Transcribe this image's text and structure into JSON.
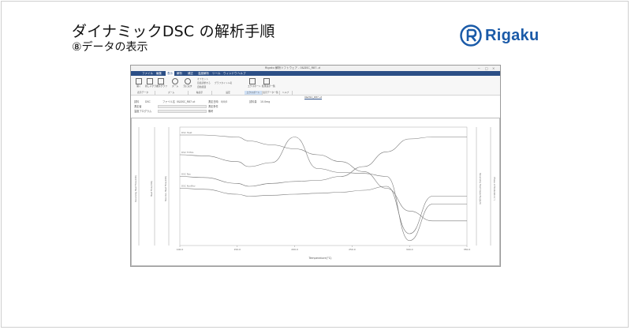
{
  "slide": {
    "title": "ダイナミックDSC の解析手順",
    "subtitle": "⑧データの表示",
    "logo_text": "Rigaku",
    "brand_color": "#1a5aa8"
  },
  "app": {
    "window_title": "Rigaku 解析ソフトウェア - 0&DSC_R87..d",
    "doc_tab": "0&DSC_R87.ut",
    "menu_color": "#2c4f86",
    "menus": [
      {
        "label": "ファイル"
      },
      {
        "label": "編集"
      },
      {
        "label": "表示"
      },
      {
        "label": "解析"
      },
      {
        "label": "補正"
      },
      {
        "label": "温度解析"
      },
      {
        "label": "ツール"
      },
      {
        "label": "ウィンドウ"
      },
      {
        "label": "ヘルプ"
      }
    ],
    "ribbon_buttons": [
      {
        "label": "開く",
        "icon": "folder-icon"
      },
      {
        "label": "新しいグラフ",
        "icon": "graph-new-icon"
      },
      {
        "label": "表示グラフ",
        "icon": "graph-icon"
      },
      {
        "label": "ズーム",
        "icon": "zoom-icon"
      },
      {
        "label": "元に戻す",
        "icon": "undo-icon"
      },
      {
        "label": "エクスポート",
        "icon": "export-icon"
      },
      {
        "label": "結果表示一覧",
        "icon": "list-icon"
      }
    ],
    "ribbon_options": [
      "オフセット",
      "目盛調整する",
      "自動範囲",
      "グラフタイトル名"
    ],
    "ribbon_groups": [
      "表示データ",
      "ズーム",
      "軸表示",
      "設定",
      "エクスポート",
      "表示データ一覧",
      "ヘルプ"
    ],
    "info": {
      "sample_label": "試料",
      "sample_name": "DSC",
      "file_label": "ファイル名",
      "file_name": "0&DSC_R87.ut",
      "measure_date_label": "測定日時",
      "measure_date": "0/0/0",
      "weight_label": "試料量",
      "weight_value": "10.0mg",
      "operator_label": "測定者",
      "condition_label": "測定条件",
      "program_label": "温度プログラム",
      "note_label": "備考"
    }
  },
  "chart_data": {
    "type": "line",
    "xlabel": "Temperature(°C)",
    "x_ticks": [
      "100.0",
      "150.0",
      "200.0",
      "250.0",
      "300.0",
      "350.0"
    ],
    "left_axis_labels": [
      "Reversing Heat Flow(mW)",
      "Heat Flow(mW)",
      "Non-Rev Heat Flow(mW)"
    ],
    "right_axis_labels": [
      "Reversing Heat Capacity(J/g·K)",
      "Phase of Modulation(°)"
    ],
    "series": [
      {
        "name": "DSC Heat",
        "values": [
          0.82,
          0.82,
          0.8,
          0.76,
          0.72,
          0.68,
          0.62,
          0.55,
          0.45,
          0.28,
          0.05,
          -0.05,
          -0.05,
          -0.05
        ]
      },
      {
        "name": "DSC TOTAL",
        "values": [
          0.62,
          0.61,
          0.55,
          0.5,
          0.54,
          0.8,
          0.48,
          0.44,
          0.43,
          0.4,
          -0.25,
          0.12,
          0.12,
          0.12
        ]
      },
      {
        "name": "DSC Rev",
        "values": [
          0.4,
          0.39,
          0.33,
          0.3,
          0.33,
          0.35,
          0.36,
          0.4,
          0.5,
          0.65,
          0.78,
          0.8,
          0.8,
          0.8
        ]
      },
      {
        "name": "DSC NonRev",
        "values": [
          0.28,
          0.27,
          0.22,
          0.2,
          0.21,
          0.22,
          0.23,
          0.24,
          0.26,
          0.3,
          -0.18,
          0.2,
          0.2,
          0.2
        ]
      }
    ],
    "x": [
      100,
      120,
      150,
      160,
      180,
      200,
      220,
      240,
      260,
      280,
      300,
      320,
      340,
      350
    ],
    "xlim": [
      100,
      350
    ],
    "grid": false
  }
}
